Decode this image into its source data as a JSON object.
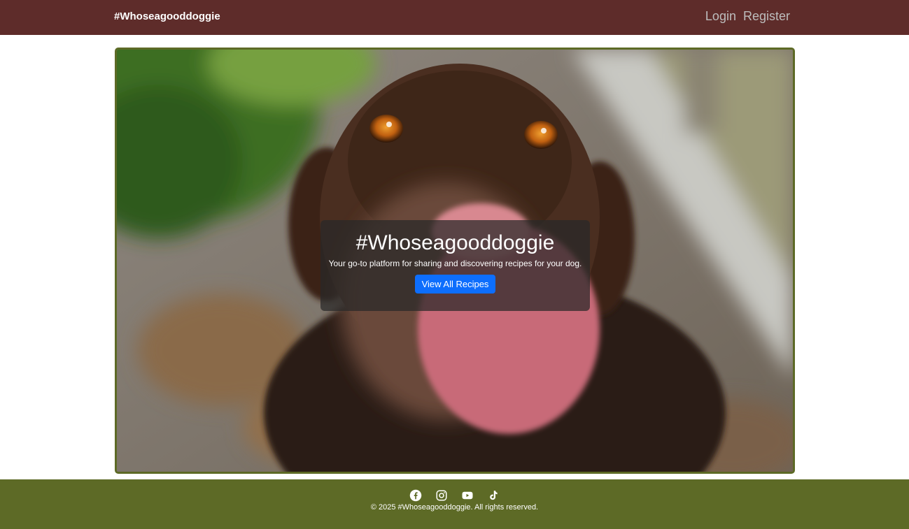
{
  "navbar": {
    "brand": "#Whoseagooddoggie",
    "links": [
      {
        "label": "Login"
      },
      {
        "label": "Register"
      }
    ]
  },
  "hero": {
    "image_icon": "dog-photo",
    "title": "#Whoseagooddoggie",
    "subtitle": "Your go-to platform for sharing and discovering recipes for your dog.",
    "cta_label": "View All Recipes"
  },
  "footer": {
    "social_icons": [
      "facebook-icon",
      "instagram-icon",
      "youtube-icon",
      "tiktok-icon"
    ],
    "copyright": "© 2025 #Whoseagooddoggie. All rights reserved."
  },
  "colors": {
    "navbar_bg": "#5e2c2a",
    "footer_bg": "#5d6a26",
    "hero_border": "#5d6a26",
    "cta_bg": "#0d6efd"
  }
}
